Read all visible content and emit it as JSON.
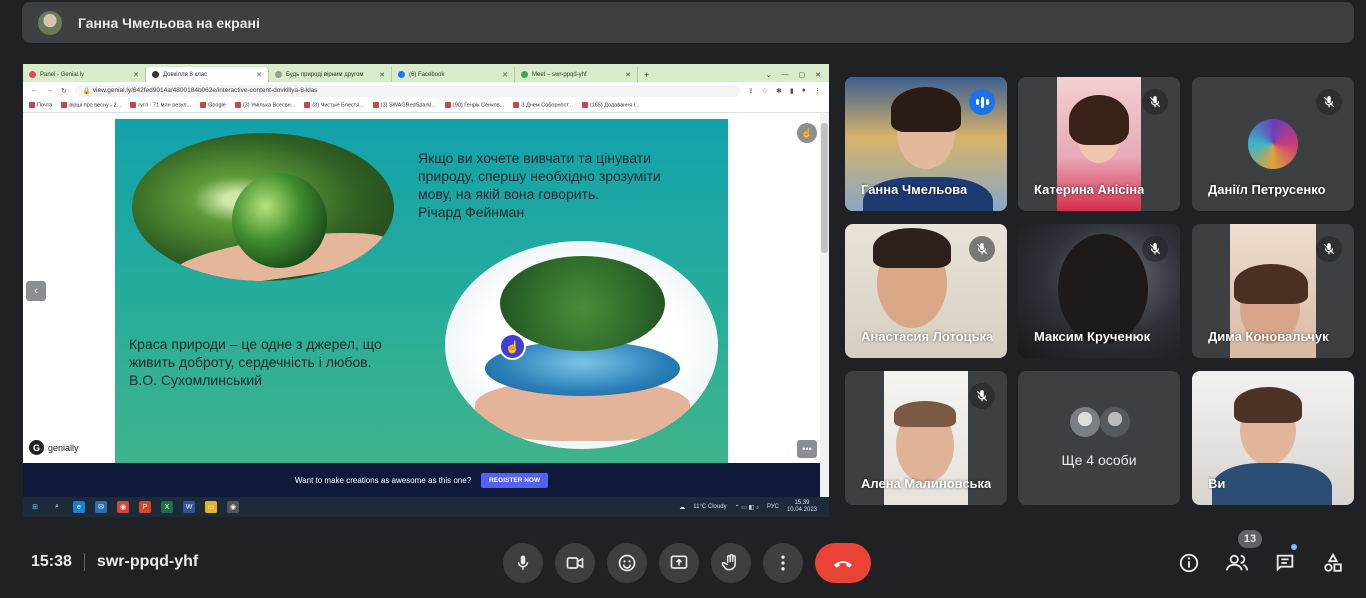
{
  "presenter_bar": {
    "title": "Ганна Чмельова на екрані"
  },
  "browser": {
    "tabs": [
      {
        "label": "Panel - Genial.ly",
        "favicon_color": "#e24c4c"
      },
      {
        "label": "Довкілля 8 клас",
        "favicon_color": "#333333"
      },
      {
        "label": "Будь природі вірним другом",
        "favicon_color": "#999999"
      },
      {
        "label": "(6) Facebook",
        "favicon_color": "#1877f2"
      },
      {
        "label": "Meet – swr-ppqd-yhf",
        "favicon_color": "#34a853"
      }
    ],
    "url": "view.genial.ly/642fed9014a/4800184b062e/interactive-content-dovkillya-8-klas",
    "bookmarks": [
      "Почта",
      "вірші про весну - 2...",
      "гугл · 71 млн резул...",
      "Google",
      "(3) Умілька Всесвн...",
      "(3) Чистые Блестя...",
      "(3) SWAGRedSparkl...",
      "(90) Генрік Сенков...",
      "З Днем Соборност...",
      "(165) Додавання і..."
    ]
  },
  "slide": {
    "quote1": "Якщо ви хочете вивчати та цінувати\nприроду, спершу необхідно зрозуміти\nмову, на якій вона говорить.\nРічард Фейнман",
    "quote2": "Краса природи – це одне з джерел, що\nживить доброту, сердечність і любов.\nВ.О. Сухомлинський",
    "logo_text": "genially",
    "prev_label": "‹",
    "more_label": "•••"
  },
  "promo": {
    "text": "Want to make creations as awesome as this one?",
    "button": "REGISTER NOW"
  },
  "taskbar": {
    "weather": "11°C  Cloudy",
    "lang": "РУС",
    "time": "15:39",
    "date": "10.04.2023"
  },
  "participants": [
    {
      "name": "Ганна Чмельова",
      "speaking": true,
      "muted": false
    },
    {
      "name": "Катерина Анісіна",
      "speaking": false,
      "muted": true
    },
    {
      "name": "Даніїл Петрусенко",
      "speaking": false,
      "muted": true
    },
    {
      "name": "Анастасия Лотоцька",
      "speaking": false,
      "muted": true
    },
    {
      "name": "Максим Крученюк",
      "speaking": false,
      "muted": true
    },
    {
      "name": "Дима Коновальчук",
      "speaking": false,
      "muted": true
    },
    {
      "name": "Алена Малиновська",
      "speaking": false,
      "muted": true
    },
    {
      "name": "Ще 4 особи",
      "speaking": false,
      "muted": false
    },
    {
      "name": "Ви",
      "speaking": false,
      "muted": false
    }
  ],
  "meeting": {
    "time": "15:38",
    "code": "swr-ppqd-yhf",
    "participant_count": "13"
  },
  "colors": {
    "background": "#202124",
    "tile": "#3c4043",
    "end_call": "#ea4335",
    "speaking_outline": "#8ab4f8"
  }
}
